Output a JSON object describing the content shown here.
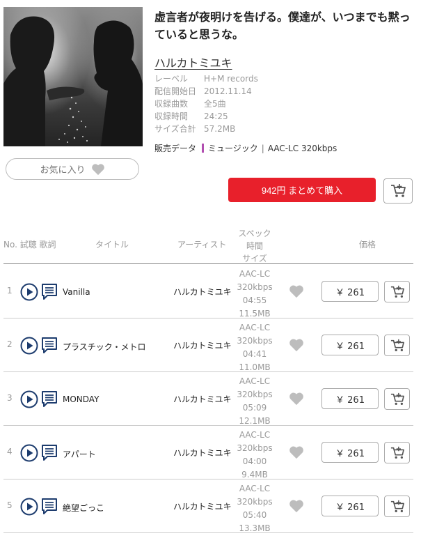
{
  "album": {
    "title": "虚言者が夜明けを告げる。僕達が、いつまでも黙っていると思うな。",
    "artist": "ハルカトミユキ",
    "meta": [
      {
        "key": "レーベル",
        "value": "H+M records"
      },
      {
        "key": "配信開始日",
        "value": "2012.11.14"
      },
      {
        "key": "収録曲数",
        "value": "全5曲"
      },
      {
        "key": "収録時間",
        "value": "24:25"
      },
      {
        "key": "サイズ合計",
        "value": "57.2MB"
      }
    ],
    "sales_label": "販売データ",
    "sales_category": "ミュージック",
    "sales_format": "AAC-LC 320kbps",
    "favorite_label": "お気に入り",
    "buy_all_label": "942円 まとめて購入"
  },
  "table_header": {
    "no": "No. 試聴 歌詞",
    "title": "タイトル",
    "artist": "アーティスト",
    "spec_1": "スペック",
    "spec_2": "時間",
    "spec_3": "サイズ",
    "price": "価格"
  },
  "tracks": [
    {
      "no": "1",
      "title": "Vanilla",
      "artist": "ハルカトミユキ",
      "codec": "AAC-LC",
      "bitrate": "320kbps",
      "duration": "04:55",
      "size": "11.5MB",
      "price": "￥ 261"
    },
    {
      "no": "2",
      "title": "プラスチック・メトロ",
      "artist": "ハルカトミユキ",
      "codec": "AAC-LC",
      "bitrate": "320kbps",
      "duration": "04:41",
      "size": "11.0MB",
      "price": "￥ 261"
    },
    {
      "no": "3",
      "title": "MONDAY",
      "artist": "ハルカトミユキ",
      "codec": "AAC-LC",
      "bitrate": "320kbps",
      "duration": "05:09",
      "size": "12.1MB",
      "price": "￥ 261"
    },
    {
      "no": "4",
      "title": "アパート",
      "artist": "ハルカトミユキ",
      "codec": "AAC-LC",
      "bitrate": "320kbps",
      "duration": "04:00",
      "size": "9.4MB",
      "price": "￥ 261"
    },
    {
      "no": "5",
      "title": "絶望ごっこ",
      "artist": "ハルカトミユキ",
      "codec": "AAC-LC",
      "bitrate": "320kbps",
      "duration": "05:40",
      "size": "13.3MB",
      "price": "￥ 261"
    }
  ],
  "icons": {
    "play": "play-circle-icon",
    "lyrics": "lyrics-icon",
    "favorite": "heart-icon",
    "cart": "cart-icon"
  },
  "colors": {
    "buy_button": "#e8202b",
    "icon_navy": "#1d3c6e",
    "category_mark": "#b14eb0",
    "heart_gray": "#bdbdbd"
  }
}
